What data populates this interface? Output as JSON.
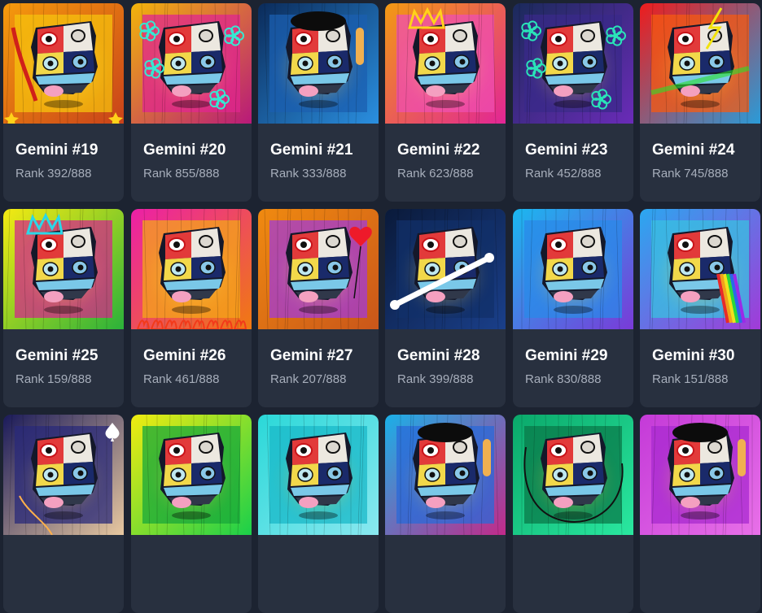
{
  "cards": [
    {
      "title": "Gemini #19",
      "rank": "Rank 392/888",
      "bg": [
        "#f59a0c",
        "#c9421a"
      ],
      "inner": "#f5c10e",
      "accent": "#d0201a",
      "icon": "star-corner-icon"
    },
    {
      "title": "Gemini #20",
      "rank": "Rank 855/888",
      "bg": [
        "#f2b40a",
        "#b8197a"
      ],
      "inner": "#e0258f",
      "accent": "#36e8d2",
      "icon": "flower-icon"
    },
    {
      "title": "Gemini #21",
      "rank": "Rank 333/888",
      "bg": [
        "#0b2b5a",
        "#2a8fe0"
      ],
      "inner": "#1b5fb0",
      "accent": "#111111",
      "icon": "beret-icon"
    },
    {
      "title": "Gemini #22",
      "rank": "Rank 623/888",
      "bg": [
        "#f39a12",
        "#e22596"
      ],
      "inner": "#ef4fb2",
      "accent": "#ffd21a",
      "icon": "crown-icon"
    },
    {
      "title": "Gemini #23",
      "rank": "Rank 452/888",
      "bg": [
        "#1a2a5a",
        "#6a2bb8"
      ],
      "inner": "#3a2a8a",
      "accent": "#2ae3b8",
      "icon": "flower-icon"
    },
    {
      "title": "Gemini #24",
      "rank": "Rank 745/888",
      "bg": [
        "#ee1c1c",
        "#2a9bd8"
      ],
      "inner": "#f55a12",
      "accent": "#f2e20c",
      "icon": "lightning-icon"
    },
    {
      "title": "Gemini #25",
      "rank": "Rank 159/888",
      "bg": [
        "#f5ea12",
        "#2ab23a"
      ],
      "inner": "#d22a8a",
      "accent": "#2ad8e8",
      "icon": "crown-icon"
    },
    {
      "title": "Gemini #26",
      "rank": "Rank 461/888",
      "bg": [
        "#ec1fa8",
        "#f07a10"
      ],
      "inner": "#f4a51a",
      "accent": "#f23a1a",
      "icon": "flame-icon"
    },
    {
      "title": "Gemini #27",
      "rank": "Rank 207/888",
      "bg": [
        "#f08a10",
        "#c9561a"
      ],
      "inner": "#a23ad8",
      "accent": "#ee1a2a",
      "icon": "heart-balloon-icon"
    },
    {
      "title": "Gemini #28",
      "rank": "Rank 399/888",
      "bg": [
        "#0a1a3a",
        "#1a3f8a"
      ],
      "inner": "#12306a",
      "accent": "#ffffff",
      "icon": "crossbones-icon"
    },
    {
      "title": "Gemini #29",
      "rank": "Rank 830/888",
      "bg": [
        "#1ab8f0",
        "#7a3ad8"
      ],
      "inner": "#2a8ae8",
      "accent": "#ffffff",
      "icon": "plain-icon"
    },
    {
      "title": "Gemini #30",
      "rank": "Rank 151/888",
      "bg": [
        "#2aa8f0",
        "#a23ad8"
      ],
      "inner": "#3ac0e0",
      "accent": "#e82a2a",
      "icon": "rainbow-icon"
    },
    {
      "title": "",
      "rank": "",
      "bg": [
        "#1a1a5a",
        "#e8c8a0"
      ],
      "inner": "#2a2a7a",
      "accent": "#ffb04a",
      "icon": "spade-icon"
    },
    {
      "title": "",
      "rank": "",
      "bg": [
        "#f2ec10",
        "#1ad04a"
      ],
      "inner": "#18a83a",
      "accent": "#f2ec10",
      "icon": "plain-icon"
    },
    {
      "title": "",
      "rank": "",
      "bg": [
        "#2ad8d8",
        "#8ae8f0"
      ],
      "inner": "#1ab8c8",
      "accent": "#ffffff",
      "icon": "plain-icon"
    },
    {
      "title": "",
      "rank": "",
      "bg": [
        "#1ab0e8",
        "#c22a8a"
      ],
      "inner": "#2a6ad8",
      "accent": "#111111",
      "icon": "beret-icon"
    },
    {
      "title": "",
      "rank": "",
      "bg": [
        "#0aa86a",
        "#2ae8a0"
      ],
      "inner": "#0a7a4a",
      "accent": "#111111",
      "icon": "doodle-icon"
    },
    {
      "title": "",
      "rank": "",
      "bg": [
        "#c43ad8",
        "#e870e8"
      ],
      "inner": "#a82ad0",
      "accent": "#111111",
      "icon": "beret-icon"
    }
  ],
  "colors": {
    "page": "#1c2331",
    "card": "#28303f",
    "title": "#ffffff",
    "rank": "#a7aebb"
  }
}
